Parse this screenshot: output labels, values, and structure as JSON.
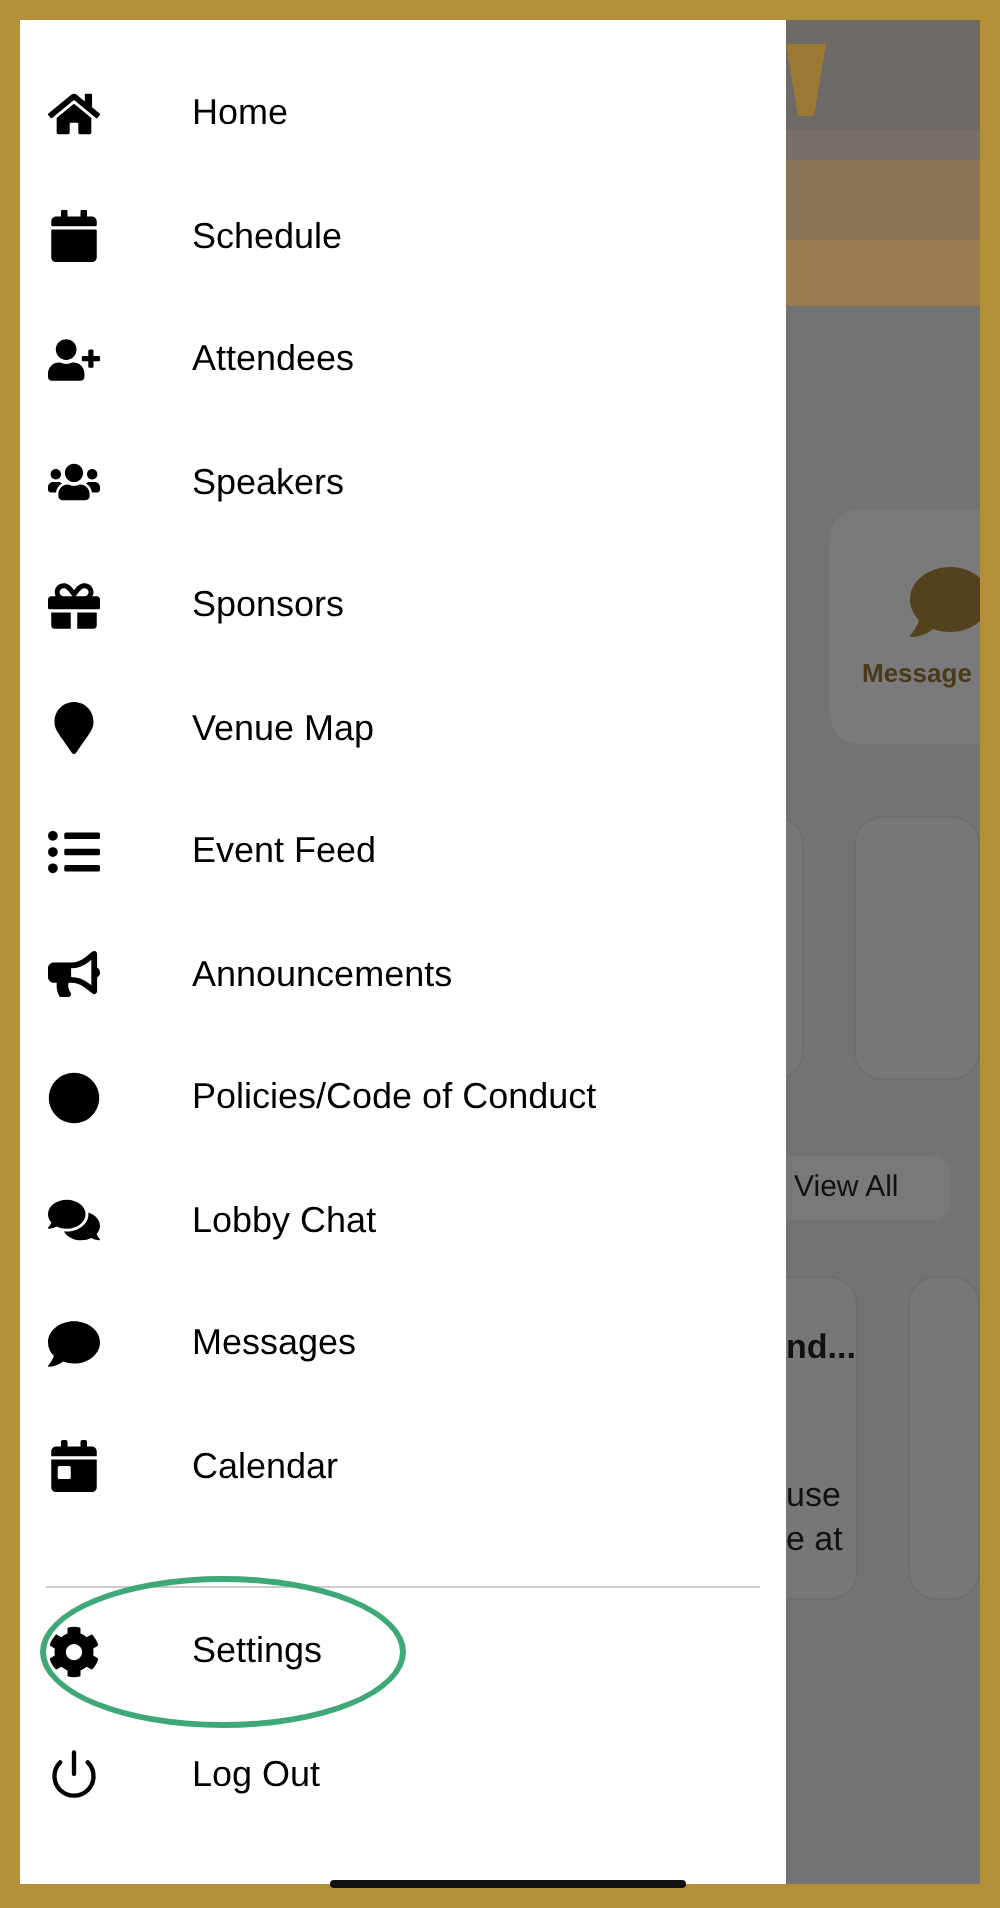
{
  "drawer": {
    "items": [
      {
        "label": "Home",
        "selected": false
      },
      {
        "label": "Schedule",
        "selected": false
      },
      {
        "label": "Attendees",
        "selected": false
      },
      {
        "label": "Speakers",
        "selected": false
      },
      {
        "label": "Sponsors",
        "selected": false
      },
      {
        "label": "Venue Map",
        "selected": false
      },
      {
        "label": "Event Feed",
        "selected": false
      },
      {
        "label": "Announcements",
        "selected": false
      },
      {
        "label": "Policies/Code of Conduct",
        "selected": false
      },
      {
        "label": "Lobby Chat",
        "selected": false
      },
      {
        "label": "Messages",
        "selected": false
      },
      {
        "label": "Calendar",
        "selected": false
      }
    ],
    "footer_items": [
      {
        "label": "Settings",
        "highlighted": true
      },
      {
        "label": "Log Out",
        "highlighted": false
      }
    ]
  },
  "background": {
    "quick_action": {
      "label": "Message"
    },
    "view_all_button": "View All",
    "card": {
      "title": "nd...",
      "text_lines": [
        "use",
        "e at"
      ]
    }
  }
}
